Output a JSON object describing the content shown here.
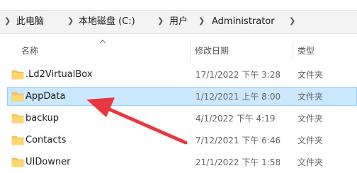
{
  "breadcrumb": {
    "items": [
      "此电脑",
      "本地磁盘 (C:)",
      "用户",
      "Administrator"
    ]
  },
  "columns": {
    "name": "名称",
    "date": "修改日期",
    "type": "类型"
  },
  "files": [
    {
      "name": ".Ld2VirtualBox",
      "date": "17/1/2022 下午 3:28",
      "type": "文件夹"
    },
    {
      "name": "AppData",
      "date": "1/12/2021 上午 8:00",
      "type": "文件夹"
    },
    {
      "name": "backup",
      "date": "4/1/2022 下午 4:19",
      "type": "文件夹"
    },
    {
      "name": "Contacts",
      "date": "7/12/2021 下午 6:46",
      "type": "文件夹"
    },
    {
      "name": "UIDowner",
      "date": "21/1/2022 下午 1:58",
      "type": "文件夹"
    }
  ],
  "colors": {
    "selection": "#cce8ff",
    "folder": "#f8c55b",
    "arrow": "#e8383d"
  },
  "icons": {
    "folder": "folder-icon",
    "separator": "chevron-right-icon",
    "sort": "chevron-up-icon",
    "arrow": "red-arrow-annotation"
  }
}
